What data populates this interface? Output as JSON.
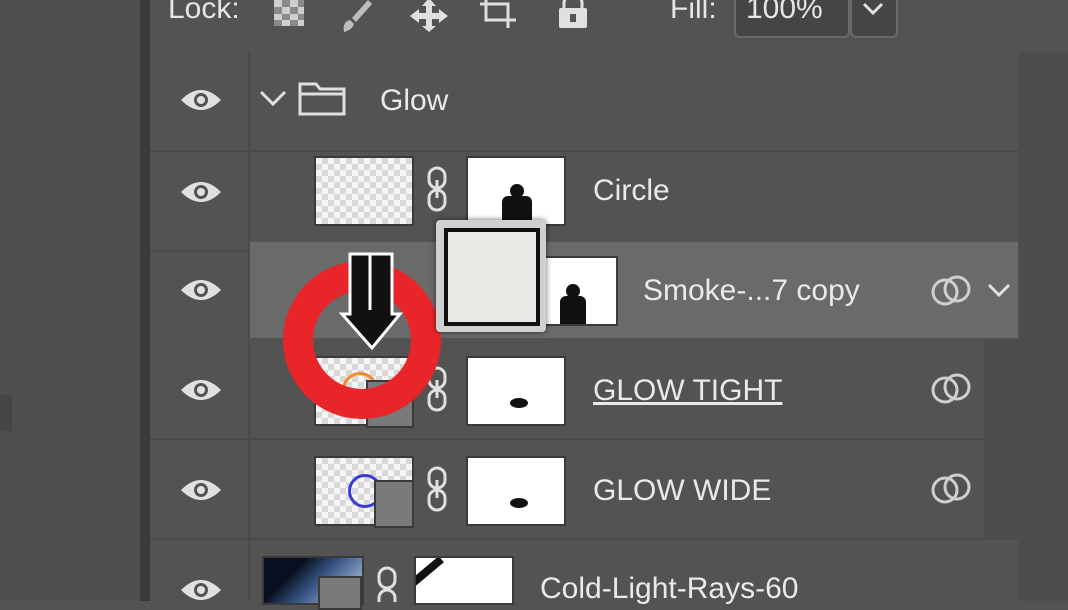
{
  "lock_bar": {
    "lock_label": "Lock:",
    "fill_label": "Fill:",
    "fill_value": "100%"
  },
  "layers": [
    {
      "name": "Glow",
      "type": "group",
      "expanded": true
    },
    {
      "name": "Circle",
      "type": "layer"
    },
    {
      "name": "Smoke-...7 copy",
      "type": "layer",
      "selected": true
    },
    {
      "name": "GLOW TIGHT",
      "type": "smart-object"
    },
    {
      "name": "GLOW WIDE",
      "type": "smart-object"
    },
    {
      "name": "Cold-Light-Rays-60",
      "type": "smart-object"
    }
  ],
  "icons": {
    "eye": "eye-icon",
    "chain": "link-icon",
    "blend": "blending-circles-icon",
    "chevron": "chevron-down-icon",
    "folder": "folder-icon"
  },
  "colors": {
    "panel_bg": "#535353",
    "selected_row": "#6a6a6a",
    "red_overlay": "#e8262a"
  }
}
